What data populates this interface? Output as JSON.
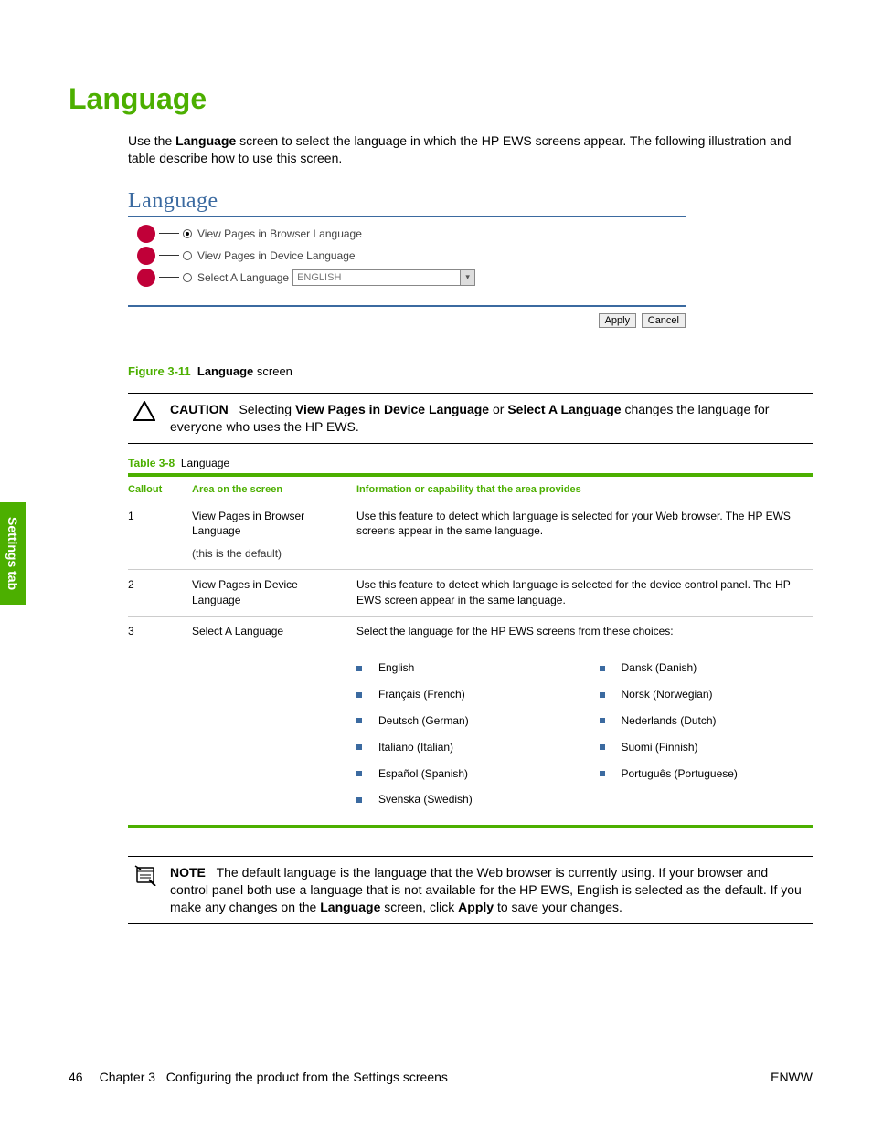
{
  "heading": "Language",
  "intro": {
    "prefix": "Use the ",
    "bold1": "Language",
    "rest": " screen to select the language in which the HP EWS screens appear. The following illustration and table describe how to use this screen."
  },
  "screenshot": {
    "title": "Language",
    "opt1": "View Pages in Browser Language",
    "opt2": "View Pages in Device Language",
    "opt3": "Select A Language",
    "dropdown_value": "ENGLISH",
    "apply": "Apply",
    "cancel": "Cancel"
  },
  "figure": {
    "num": "Figure 3-11",
    "label_bold": "Language",
    "label_rest": " screen"
  },
  "caution": {
    "label": "CAUTION",
    "pre": "Selecting ",
    "b1": "View Pages in Device Language",
    "mid": " or ",
    "b2": "Select A Language",
    "post": " changes the language for everyone who uses the HP EWS."
  },
  "table": {
    "caption_num": "Table 3-8",
    "caption_label": "Language",
    "h1": "Callout",
    "h2": "Area on the screen",
    "h3": "Information or capability that the area provides",
    "rows": [
      {
        "c1": "1",
        "c2": "View Pages in Browser Language",
        "c2_sub": "(this is the default)",
        "c3": "Use this feature to detect which language is selected for your Web browser. The HP EWS screens appear in the same language."
      },
      {
        "c1": "2",
        "c2": "View Pages in Device Language",
        "c3": "Use this feature to detect which language is selected for the device control panel. The HP EWS screen appear in the same language."
      },
      {
        "c1": "3",
        "c2": "Select A Language",
        "c3": "Select the language for the HP EWS screens from these choices:"
      }
    ],
    "langs_left": [
      "English",
      "Français (French)",
      "Deutsch (German)",
      "Italiano (Italian)",
      "Español (Spanish)",
      "Svenska (Swedish)"
    ],
    "langs_right": [
      "Dansk (Danish)",
      "Norsk (Norwegian)",
      "Nederlands (Dutch)",
      "Suomi (Finnish)",
      "Português (Portuguese)"
    ]
  },
  "note": {
    "label": "NOTE",
    "t1": "The default language is the language that the Web browser is currently using. If your browser and control panel both use a language that is not available for the HP EWS, English is selected as the default. If you make any changes on the ",
    "b1": "Language",
    "t2": " screen, click ",
    "b2": "Apply",
    "t3": " to save your changes."
  },
  "side_tab": "Settings tab",
  "footer": {
    "page": "46",
    "chapter_label": "Chapter 3",
    "chapter_title": "Configuring the product from the Settings screens",
    "right": "ENWW"
  }
}
